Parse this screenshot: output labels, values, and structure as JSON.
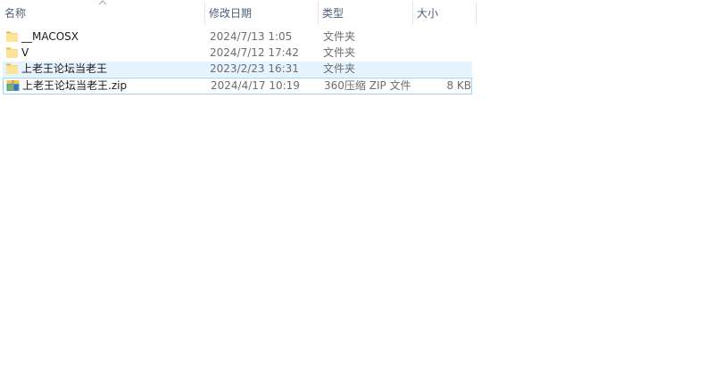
{
  "columns": {
    "name": "名称",
    "date": "修改日期",
    "type": "类型",
    "size": "大小"
  },
  "files": [
    {
      "name": "__MACOSX",
      "date": "2024/7/13 1:05",
      "type": "文件夹",
      "size": "",
      "icon": "folder-icon"
    },
    {
      "name": "V",
      "date": "2024/7/12 17:42",
      "type": "文件夹",
      "size": "",
      "icon": "folder-icon"
    },
    {
      "name": "上老王论坛当老王",
      "date": "2023/2/23 16:31",
      "type": "文件夹",
      "size": "",
      "icon": "folder-icon"
    },
    {
      "name": "上老王论坛当老王.zip",
      "date": "2024/4/17 10:19",
      "type": "360压缩 ZIP 文件",
      "size": "8 KB",
      "icon": "zip-archive-icon"
    }
  ],
  "colors": {
    "header_text": "#4c607a",
    "hover_background": "#e5f3ff",
    "focus_border": "#99d1ff",
    "folder_yellow": "#f8d775"
  }
}
